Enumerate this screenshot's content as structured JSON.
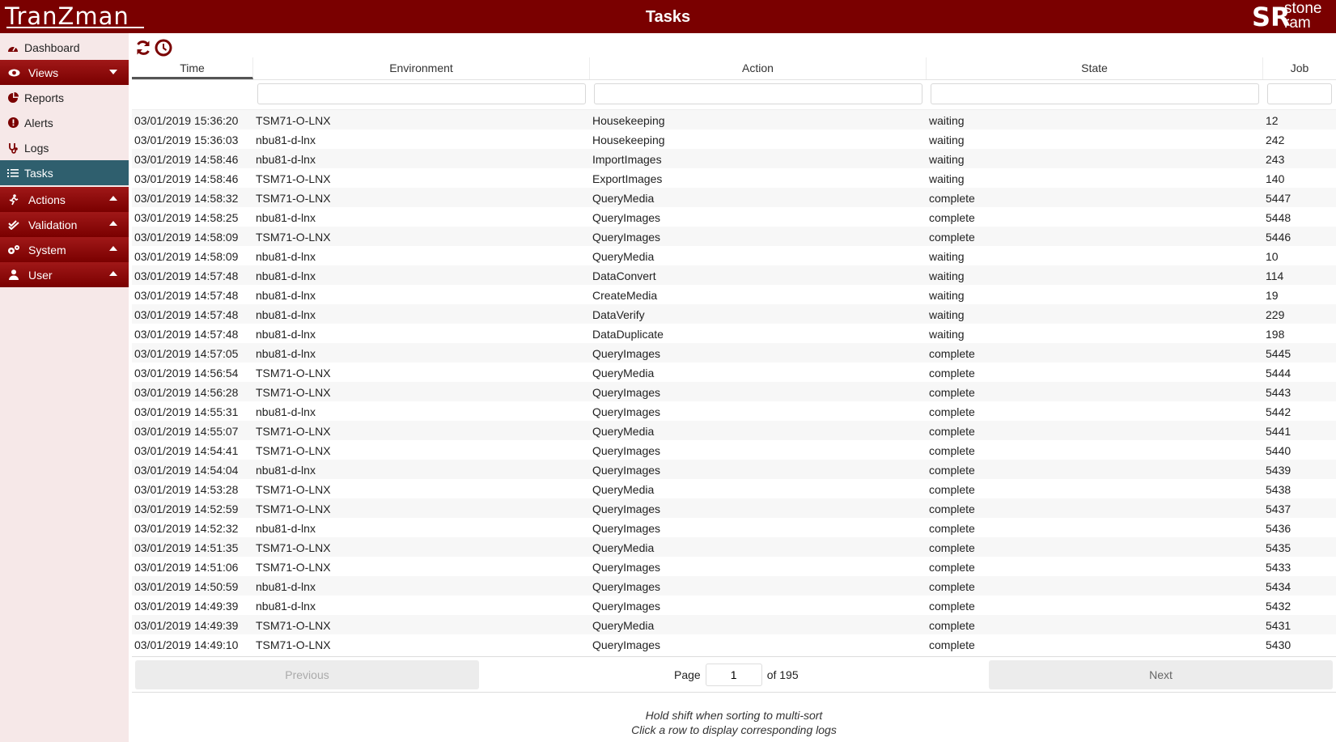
{
  "header": {
    "logo": "TranZman",
    "title": "Tasks",
    "brand_mark": "SR",
    "brand_line1": "stone",
    "brand_line2": "ram"
  },
  "sidebar": {
    "items": [
      {
        "label": "Dashboard",
        "icon": "dashboard-icon"
      },
      {
        "label": "Views",
        "icon": "eye-icon",
        "expanded": true
      },
      {
        "label": "Reports",
        "icon": "pie-chart-icon"
      },
      {
        "label": "Alerts",
        "icon": "alert-icon"
      },
      {
        "label": "Logs",
        "icon": "stethoscope-icon"
      },
      {
        "label": "Tasks",
        "icon": "tasks-icon",
        "active": true
      },
      {
        "label": "Actions",
        "icon": "running-icon"
      },
      {
        "label": "Validation",
        "icon": "double-check-icon"
      },
      {
        "label": "System",
        "icon": "cogs-icon"
      },
      {
        "label": "User",
        "icon": "user-icon"
      }
    ]
  },
  "toolbar": {
    "refresh_icon": "refresh-icon",
    "auto_refresh_icon": "clock-icon"
  },
  "table": {
    "columns": [
      "Time",
      "Environment",
      "Action",
      "State",
      "Job"
    ],
    "sorted_column": "Time",
    "rows": [
      [
        "03/01/2019 15:36:20",
        "TSM71-O-LNX",
        "Housekeeping",
        "waiting",
        "12"
      ],
      [
        "03/01/2019 15:36:03",
        "nbu81-d-lnx",
        "Housekeeping",
        "waiting",
        "242"
      ],
      [
        "03/01/2019 14:58:46",
        "nbu81-d-lnx",
        "ImportImages",
        "waiting",
        "243"
      ],
      [
        "03/01/2019 14:58:46",
        "TSM71-O-LNX",
        "ExportImages",
        "waiting",
        "140"
      ],
      [
        "03/01/2019 14:58:32",
        "TSM71-O-LNX",
        "QueryMedia",
        "complete",
        "5447"
      ],
      [
        "03/01/2019 14:58:25",
        "nbu81-d-lnx",
        "QueryImages",
        "complete",
        "5448"
      ],
      [
        "03/01/2019 14:58:09",
        "TSM71-O-LNX",
        "QueryImages",
        "complete",
        "5446"
      ],
      [
        "03/01/2019 14:58:09",
        "nbu81-d-lnx",
        "QueryMedia",
        "waiting",
        "10"
      ],
      [
        "03/01/2019 14:57:48",
        "nbu81-d-lnx",
        "DataConvert",
        "waiting",
        "114"
      ],
      [
        "03/01/2019 14:57:48",
        "nbu81-d-lnx",
        "CreateMedia",
        "waiting",
        "19"
      ],
      [
        "03/01/2019 14:57:48",
        "nbu81-d-lnx",
        "DataVerify",
        "waiting",
        "229"
      ],
      [
        "03/01/2019 14:57:48",
        "nbu81-d-lnx",
        "DataDuplicate",
        "waiting",
        "198"
      ],
      [
        "03/01/2019 14:57:05",
        "nbu81-d-lnx",
        "QueryImages",
        "complete",
        "5445"
      ],
      [
        "03/01/2019 14:56:54",
        "TSM71-O-LNX",
        "QueryMedia",
        "complete",
        "5444"
      ],
      [
        "03/01/2019 14:56:28",
        "TSM71-O-LNX",
        "QueryImages",
        "complete",
        "5443"
      ],
      [
        "03/01/2019 14:55:31",
        "nbu81-d-lnx",
        "QueryImages",
        "complete",
        "5442"
      ],
      [
        "03/01/2019 14:55:07",
        "TSM71-O-LNX",
        "QueryMedia",
        "complete",
        "5441"
      ],
      [
        "03/01/2019 14:54:41",
        "TSM71-O-LNX",
        "QueryImages",
        "complete",
        "5440"
      ],
      [
        "03/01/2019 14:54:04",
        "nbu81-d-lnx",
        "QueryImages",
        "complete",
        "5439"
      ],
      [
        "03/01/2019 14:53:28",
        "TSM71-O-LNX",
        "QueryMedia",
        "complete",
        "5438"
      ],
      [
        "03/01/2019 14:52:59",
        "TSM71-O-LNX",
        "QueryImages",
        "complete",
        "5437"
      ],
      [
        "03/01/2019 14:52:32",
        "nbu81-d-lnx",
        "QueryImages",
        "complete",
        "5436"
      ],
      [
        "03/01/2019 14:51:35",
        "TSM71-O-LNX",
        "QueryMedia",
        "complete",
        "5435"
      ],
      [
        "03/01/2019 14:51:06",
        "TSM71-O-LNX",
        "QueryImages",
        "complete",
        "5433"
      ],
      [
        "03/01/2019 14:50:59",
        "nbu81-d-lnx",
        "QueryImages",
        "complete",
        "5434"
      ],
      [
        "03/01/2019 14:49:39",
        "nbu81-d-lnx",
        "QueryImages",
        "complete",
        "5432"
      ],
      [
        "03/01/2019 14:49:39",
        "TSM71-O-LNX",
        "QueryMedia",
        "complete",
        "5431"
      ],
      [
        "03/01/2019 14:49:10",
        "TSM71-O-LNX",
        "QueryImages",
        "complete",
        "5430"
      ]
    ]
  },
  "pagination": {
    "previous_label": "Previous",
    "next_label": "Next",
    "page_label": "Page",
    "current_page": "1",
    "total_label": "of 195"
  },
  "hints": {
    "line1": "Hold shift when sorting to multi-sort",
    "line2": "Click a row to display corresponding logs"
  },
  "colors": {
    "brand": "#7a0000",
    "active_nav": "#2f5f6e",
    "sidebar_bg": "#f6e8e8"
  }
}
